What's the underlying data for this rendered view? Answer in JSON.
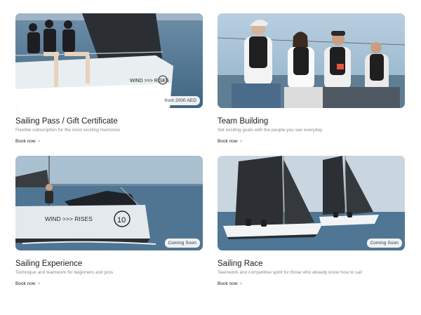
{
  "cards": [
    {
      "image": "sailboat-crew-photo",
      "badge": "from 2000 AED",
      "title": "Sailing Pass / Gift Certificate",
      "description": "Flexible subscription for the most exciting memories",
      "cta": "Book now",
      "hull_text": "WIND >>> RISES"
    },
    {
      "image": "team-on-boat-photo",
      "badge": "",
      "title": "Team Building",
      "description": "Set exciting goals with the people you see everyday",
      "cta": "Book now"
    },
    {
      "image": "sailboat-hull-photo",
      "badge": "Coming Soon",
      "title": "Sailing Experience",
      "description": "Technique and teamwork for beginners and pros",
      "cta": "Book now",
      "hull_text": "WIND >>> RISES",
      "sail_number": "10"
    },
    {
      "image": "sailboat-race-photo",
      "badge": "Coming Soon",
      "title": "Sailing Race",
      "description": "Teamwork and competitive spirit for those who already know how to sail",
      "cta": "Book now"
    }
  ],
  "icons": {
    "cta_arrow": "chevron-right-icon"
  },
  "colors": {
    "text": "#1d1d1f",
    "muted": "#8a8a8e",
    "badge_bg": "#ffffff"
  }
}
